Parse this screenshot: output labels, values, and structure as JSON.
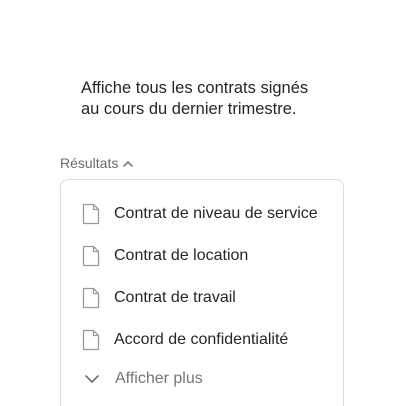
{
  "query": {
    "line1": "Affiche tous les contrats signés",
    "line2": "au cours du dernier trimestre."
  },
  "results": {
    "label": "Résultats",
    "toggle_icon": "chevron-up-icon",
    "items": [
      {
        "icon": "document-icon",
        "label": "Contrat de niveau de service"
      },
      {
        "icon": "document-icon",
        "label": "Contrat de location"
      },
      {
        "icon": "document-icon",
        "label": "Contrat de travail"
      },
      {
        "icon": "document-icon",
        "label": "Accord de confidentialité"
      }
    ],
    "show_more": {
      "icon": "chevron-down-icon",
      "label": "Afficher plus"
    }
  },
  "colors": {
    "text": "#262626",
    "muted": "#757575",
    "border": "#dcdcdc",
    "icon": "#9a9a9a"
  }
}
